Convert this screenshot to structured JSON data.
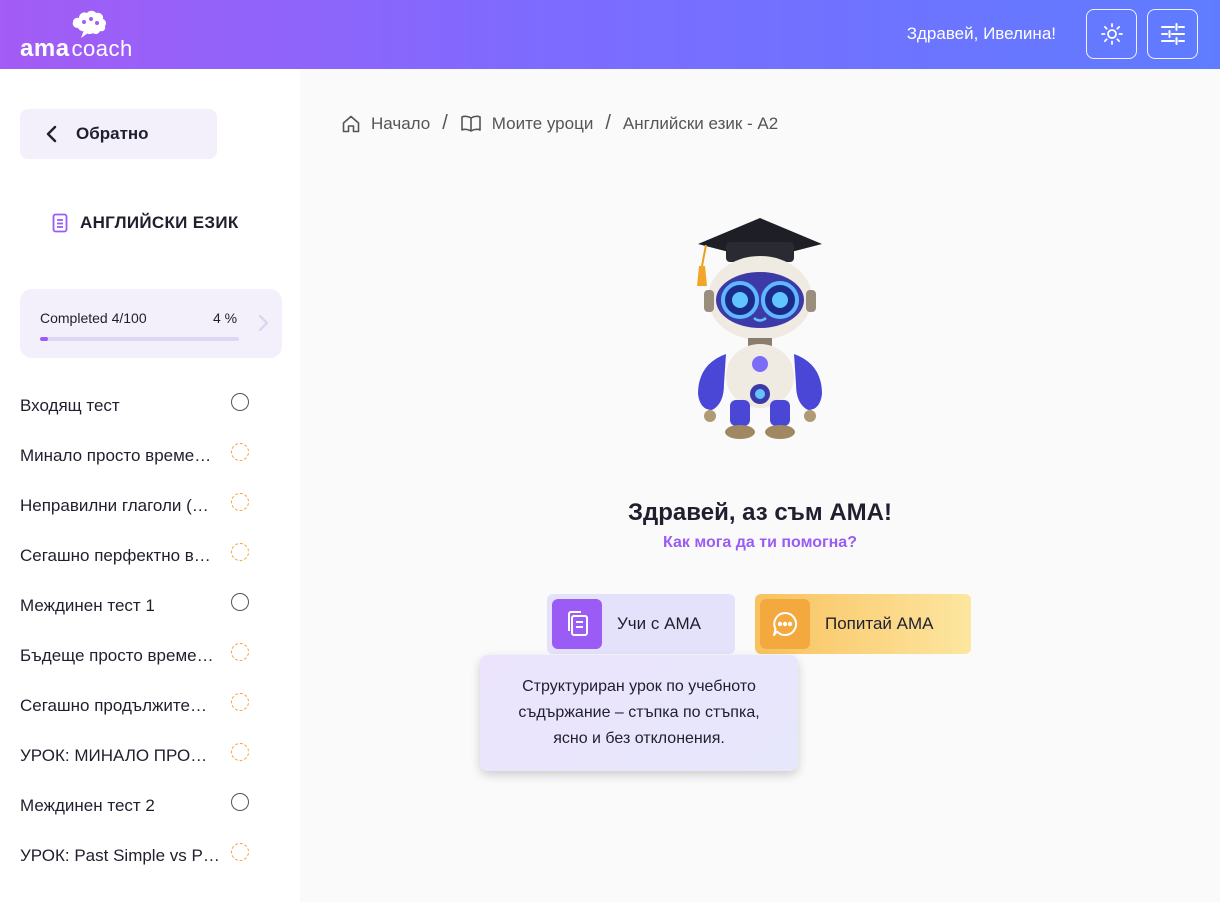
{
  "colors": {
    "accent": "#9b5cf5",
    "pending": "#f0a63a",
    "header_start": "#a35cf5",
    "header_end": "#5f7cff"
  },
  "header": {
    "logo_main": "ama",
    "logo_sub": "coach",
    "greeting": "Здравей, Ивелина!",
    "theme_icon": "sun-icon",
    "settings_icon": "sliders-icon"
  },
  "sidebar": {
    "back_label": "Обратно",
    "course_title": "АНГЛИЙСКИ ЕЗИК",
    "progress": {
      "label": "Completed 4/100",
      "percent_text": "4 %",
      "fraction": 0.04
    },
    "lessons": [
      {
        "name": "Входящ тест",
        "status": "todo"
      },
      {
        "name": "Минало просто време…",
        "status": "pending"
      },
      {
        "name": "Неправилни глаголи (…",
        "status": "pending"
      },
      {
        "name": "Сегашно перфектно в…",
        "status": "pending"
      },
      {
        "name": "Междинен тест 1",
        "status": "todo"
      },
      {
        "name": "Бъдеще просто време…",
        "status": "pending"
      },
      {
        "name": "Сегашно продължите…",
        "status": "pending"
      },
      {
        "name": "УРОК: МИНАЛО ПРО…",
        "status": "pending"
      },
      {
        "name": "Междинен тест 2",
        "status": "todo"
      },
      {
        "name": "УРОК: Past Simple vs P…",
        "status": "pending"
      }
    ]
  },
  "breadcrumb": [
    "Начало",
    "Моите уроци",
    "Английски език - А2"
  ],
  "main": {
    "title": "Здравей, аз съм АМА!",
    "subtitle": "Как мога да ти помогна?",
    "learn_label": "Учи с АМА",
    "ask_label": "Попитай АМА",
    "tooltip": "Структуриран урок по учебното съдържание – стъпка по стъпка, ясно и без отклонения."
  }
}
